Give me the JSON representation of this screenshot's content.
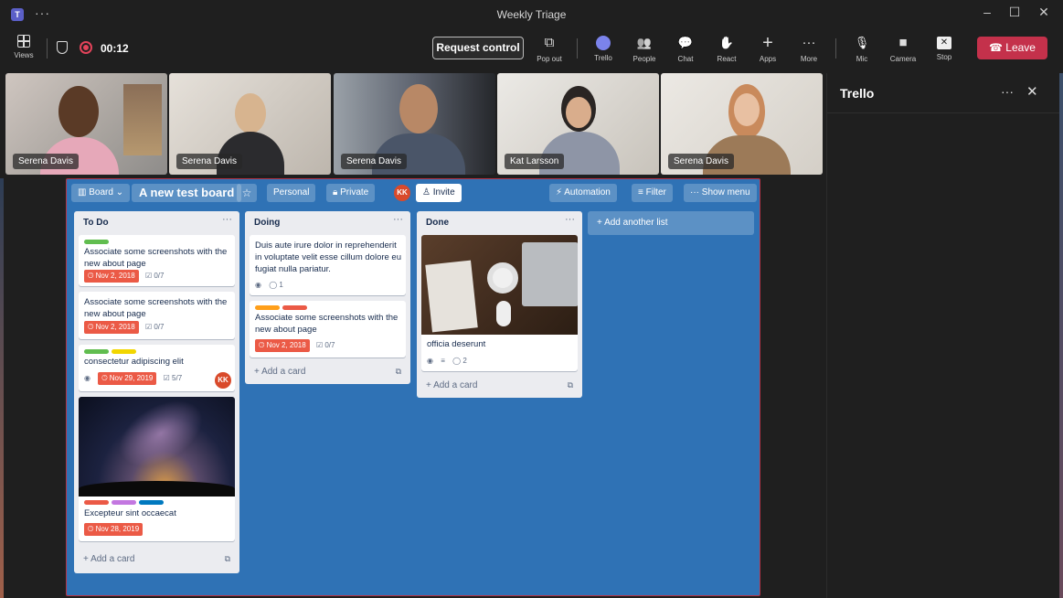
{
  "window": {
    "title": "Weekly Triage"
  },
  "toolbar": {
    "views": "Views",
    "timer": "00:12",
    "request_control": "Request control",
    "items": [
      {
        "id": "popout",
        "label": "Pop out",
        "glyph": "⧉"
      },
      {
        "id": "trello",
        "label": "Trello",
        "glyph": ""
      },
      {
        "id": "people",
        "label": "People",
        "glyph": "👥"
      },
      {
        "id": "chat",
        "label": "Chat",
        "glyph": "💬"
      },
      {
        "id": "react",
        "label": "React",
        "glyph": "✋"
      },
      {
        "id": "apps",
        "label": "Apps",
        "glyph": "+"
      },
      {
        "id": "more",
        "label": "More",
        "glyph": "···"
      },
      {
        "id": "mic",
        "label": "Mic",
        "glyph": "🎙"
      },
      {
        "id": "camera",
        "label": "Camera",
        "glyph": "■"
      },
      {
        "id": "stop",
        "label": "Stop",
        "glyph": "✕"
      }
    ],
    "leave": "Leave"
  },
  "participants": [
    {
      "name": "Serena Davis"
    },
    {
      "name": "Serena Davis"
    },
    {
      "name": "Serena Davis"
    },
    {
      "name": "Kat Larsson"
    },
    {
      "name": "Serena Davis"
    }
  ],
  "side_panel": {
    "title": "Trello"
  },
  "board": {
    "view": "Board",
    "title": "A new test board",
    "star": "☆",
    "visibility_personal": "Personal",
    "visibility_private": "Private",
    "member_initials": "KK",
    "invite": "Invite",
    "automation": "Automation",
    "filter": "Filter",
    "show_menu": "Show menu",
    "add_another_list": "+ Add another list",
    "add_card": "+ Add a card",
    "lists": [
      {
        "name": "To Do",
        "cards": [
          {
            "title": "Associate some screenshots with the new about page",
            "due": "Nov 2, 2018",
            "checklist": "0/7"
          },
          {
            "title": "Associate some screenshots with the new about page",
            "due": "Nov 2, 2018",
            "checklist": "0/7"
          },
          {
            "title": "consectetur adipiscing elit",
            "due": "Nov 29, 2019",
            "checklist": "5/7",
            "member": "KK"
          },
          {
            "title": "Excepteur sint occaecat",
            "due": "Nov 28, 2019"
          }
        ]
      },
      {
        "name": "Doing",
        "cards": [
          {
            "title": "Duis aute irure dolor in reprehenderit in voluptate velit esse cillum dolore eu fugiat nulla pariatur.",
            "comments": "1"
          },
          {
            "title": "Associate some screenshots with the new about page",
            "due": "Nov 2, 2018",
            "checklist": "0/7"
          }
        ]
      },
      {
        "name": "Done",
        "cards": [
          {
            "title": "officia deserunt",
            "comments": "2"
          }
        ]
      }
    ]
  },
  "colors": {
    "board_bg": "#2f72b5",
    "leave_red": "#c4314b",
    "due_red": "#eb5a46",
    "label_green": "#61bd4f",
    "label_yellow": "#f2d600",
    "label_orange": "#ff9f1a",
    "label_red": "#eb5a46",
    "label_purple": "#c377e0",
    "label_blue": "#0079bf"
  }
}
